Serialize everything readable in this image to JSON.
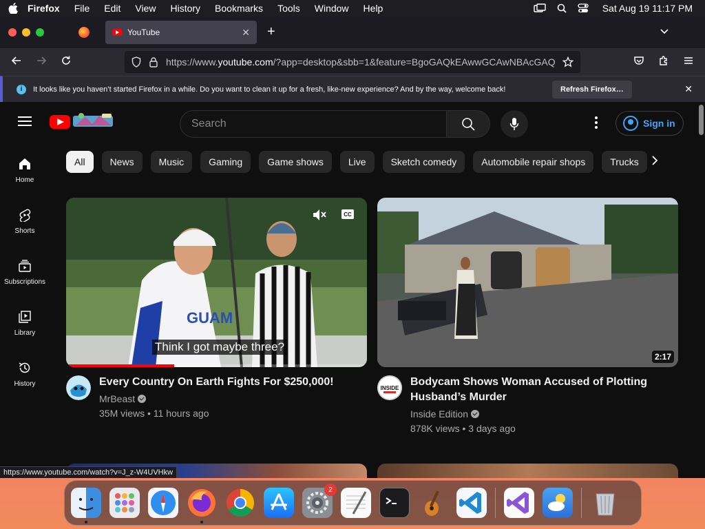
{
  "menubar": {
    "app_name": "Firefox",
    "items": [
      "File",
      "Edit",
      "View",
      "History",
      "Bookmarks",
      "Tools",
      "Window",
      "Help"
    ],
    "clock": "Sat Aug 19  11:17 PM"
  },
  "browser": {
    "tab_title": "YouTube",
    "url_prefix": "https://www.",
    "url_domain": "youtube.com",
    "url_rest": "/?app=desktop&sbb=1&feature=BgoGAQkEAwwGCAwNBAcGAQ",
    "notification": "It looks like you haven’t started Firefox in a while. Do you want to clean it up for a fresh, like-new experience? And by the way, welcome back!",
    "refresh_label": "Refresh Firefox…",
    "status_url": "https://www.youtube.com/watch?v=J_z-W4UVHkw"
  },
  "youtube": {
    "search_placeholder": "Search",
    "signin_label": "Sign in",
    "chips": [
      "All",
      "News",
      "Music",
      "Gaming",
      "Game shows",
      "Live",
      "Sketch comedy",
      "Automobile repair shops",
      "Trucks"
    ],
    "guide": [
      {
        "label": "Home",
        "icon": "home-icon"
      },
      {
        "label": "Shorts",
        "icon": "shorts-icon"
      },
      {
        "label": "Subscriptions",
        "icon": "subscriptions-icon"
      },
      {
        "label": "Library",
        "icon": "library-icon"
      },
      {
        "label": "History",
        "icon": "history-icon"
      }
    ],
    "videos": [
      {
        "title": "Every Country On Earth Fights For $250,000!",
        "channel": "MrBeast",
        "stats": "35M views • 11 hours ago",
        "caption": "Think I got maybe three?",
        "progress_pct": 36
      },
      {
        "title": "Bodycam Shows Woman Accused of Plotting Husband’s Murder",
        "channel": "Inside Edition",
        "stats": "878K views • 3 days ago",
        "duration": "2:17",
        "channel_logo_text": "INSIDE"
      }
    ]
  },
  "dock": {
    "apps": [
      "finder-icon",
      "launchpad-icon",
      "safari-icon",
      "firefox-icon",
      "chrome-icon",
      "app-store-icon",
      "system-settings-icon",
      "textedit-icon",
      "terminal-icon",
      "garageband-icon",
      "vscode-icon",
      "visual-studio-icon",
      "weather-icon",
      "trash-icon"
    ],
    "settings_badge": "2"
  }
}
